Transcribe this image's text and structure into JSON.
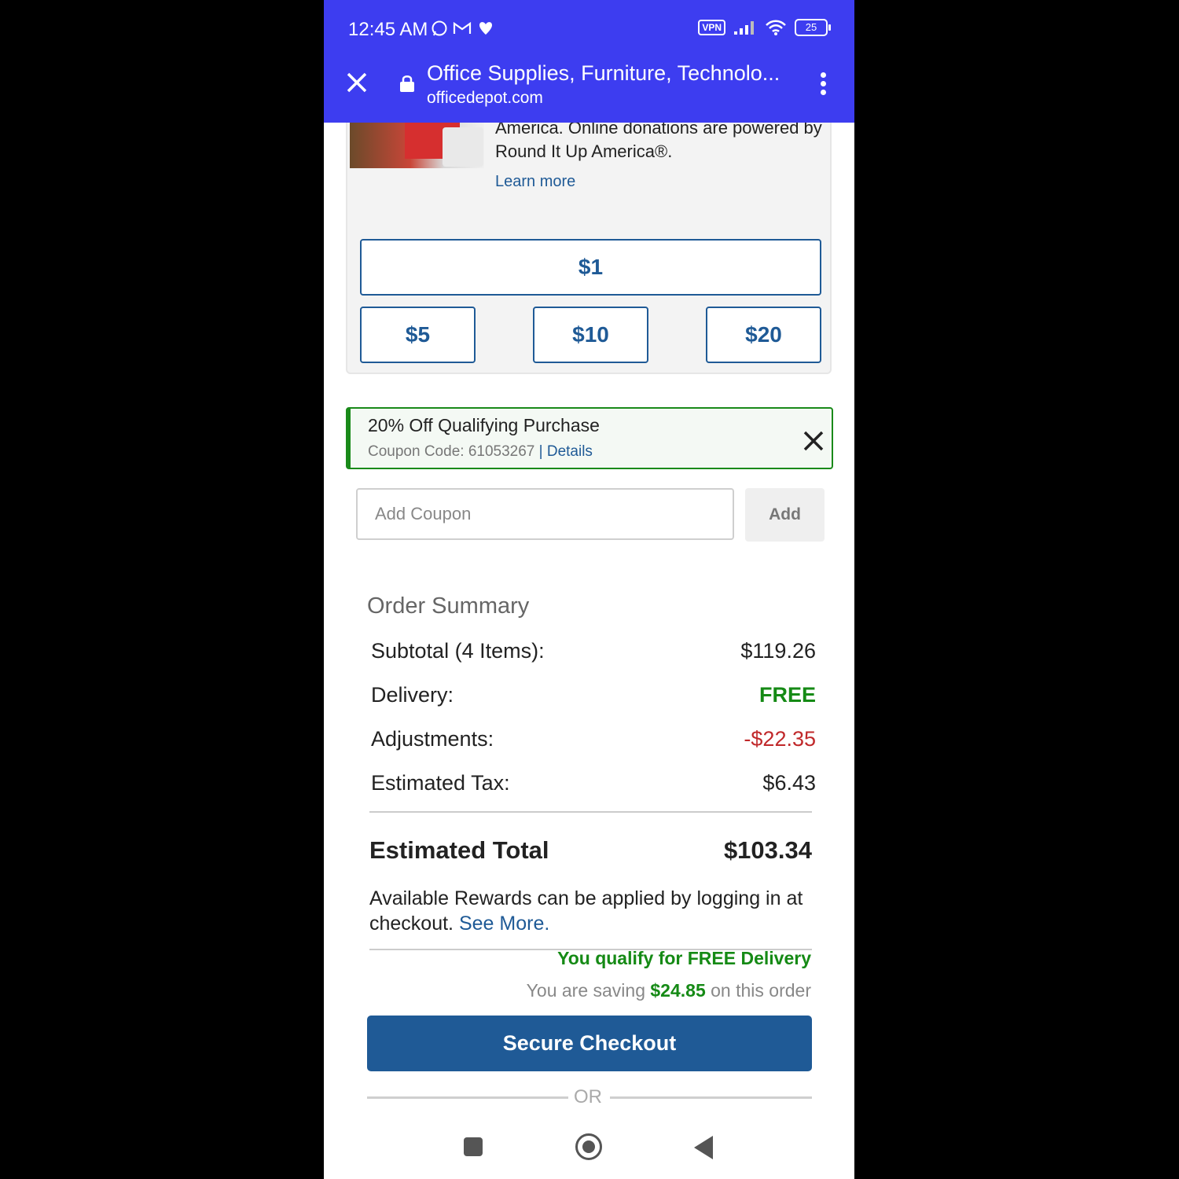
{
  "status": {
    "time": "12:45 AM",
    "vpn_label": "VPN",
    "battery": "25"
  },
  "browser": {
    "title": "Office Supplies, Furniture, Technolo...",
    "url": "officedepot.com"
  },
  "donation": {
    "text": "America. Online donations are powered by Round It Up America®.",
    "learn_more": "Learn more",
    "amounts": [
      "$1",
      "$5",
      "$10",
      "$20"
    ]
  },
  "coupon": {
    "title": "20% Off Qualifying Purchase",
    "code_label": "Coupon Code: 61053267",
    "separator": "|",
    "details": "Details",
    "input_placeholder": "Add Coupon",
    "add_label": "Add"
  },
  "order_summary": {
    "heading": "Order Summary",
    "rows": [
      {
        "label": "Subtotal (4 Items):",
        "value": "$119.26"
      },
      {
        "label": "Delivery:",
        "value": "FREE"
      },
      {
        "label": "Adjustments:",
        "value": "-$22.35"
      },
      {
        "label": "Estimated Tax:",
        "value": "$6.43"
      }
    ],
    "total_label": "Estimated Total",
    "total_value": "$103.34",
    "rewards_text": "Available Rewards can be applied by logging in at checkout.",
    "see_more": "See More.",
    "free_delivery": "You qualify for FREE Delivery",
    "saving_prefix": "You are saving",
    "saving_amount": "$24.85",
    "saving_suffix": "on this order",
    "checkout_label": "Secure Checkout",
    "or_label": "OR"
  },
  "colors": {
    "toolbar": "#3d3df0",
    "brand_blue": "#1f5a96",
    "success_green": "#158a15",
    "negative_red": "#c0282a"
  }
}
